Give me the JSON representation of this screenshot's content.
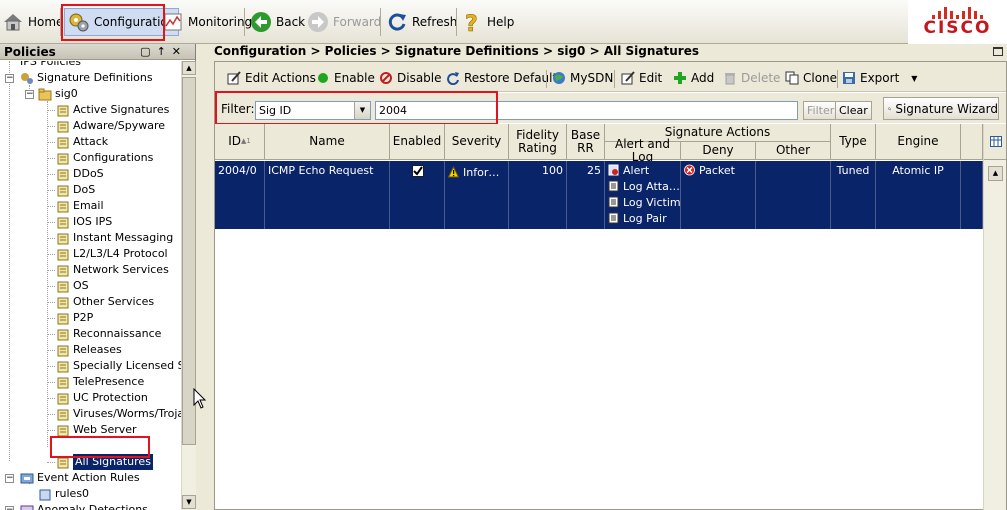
{
  "toolbar": {
    "home": "Home",
    "configuration": "Configuration",
    "monitoring": "Monitoring",
    "back": "Back",
    "forward": "Forward",
    "refresh": "Refresh",
    "help": "Help"
  },
  "brand": {
    "name": "CISCO",
    "color": "#c4161c"
  },
  "left_panel": {
    "title": "Policies",
    "tree": {
      "top_partial": "IPS Policies",
      "signature_definitions": "Signature Definitions",
      "sig0": "sig0",
      "categories": [
        "Active Signatures",
        "Adware/Spyware",
        "Attack",
        "Configurations",
        "DDoS",
        "DoS",
        "Email",
        "IOS IPS",
        "Instant Messaging",
        "L2/L3/L4 Protocol",
        "Network Services",
        "OS",
        "Other Services",
        "P2P",
        "Reconnaissance",
        "Releases",
        "Specially Licensed Signatures",
        "TelePresence",
        "UC Protection",
        "Viruses/Worms/Trojans",
        "Web Server"
      ],
      "selected": "All Signatures",
      "event_action_rules": "Event Action Rules",
      "rules0": "rules0",
      "anomaly_detections": "Anomaly Detections"
    }
  },
  "breadcrumb": "Configuration > Policies > Signature Definitions > sig0 > All Signatures",
  "actions": {
    "edit_actions": "Edit Actions",
    "enable": "Enable",
    "disable": "Disable",
    "restore_default": "Restore Default",
    "mysdn": "MySDN",
    "edit": "Edit",
    "add": "Add",
    "delete": "Delete",
    "clone": "Clone",
    "export": "Export"
  },
  "filter": {
    "label": "Filter:",
    "field": "Sig ID",
    "value": "2004",
    "filter_button": "Filter",
    "clear_button": "Clear",
    "wizard_button": "Signature Wizard"
  },
  "table": {
    "headers": {
      "id": "ID",
      "name": "Name",
      "enabled": "Enabled",
      "severity": "Severity",
      "fidelity": "Fidelity Rating",
      "base_rr": "Base RR",
      "signature_actions": "Signature Actions",
      "alert_and_log": "Alert and Log",
      "deny": "Deny",
      "other": "Other",
      "type": "Type",
      "engine": "Engine"
    },
    "rows": [
      {
        "id": "2004/0",
        "name": "ICMP Echo Request",
        "enabled": true,
        "severity": "Infor…",
        "fidelity": "100",
        "base_rr": "25",
        "alert_and_log": [
          "Alert",
          "Log Atta…",
          "Log Victim",
          "Log Pair"
        ],
        "deny": "Packet",
        "other": "",
        "type": "Tuned",
        "engine": "Atomic IP"
      }
    ]
  },
  "colors": {
    "selection": "#0a246a",
    "highlight": "#e0141e",
    "enable": "#1fa51f",
    "disable": "#c02020"
  }
}
